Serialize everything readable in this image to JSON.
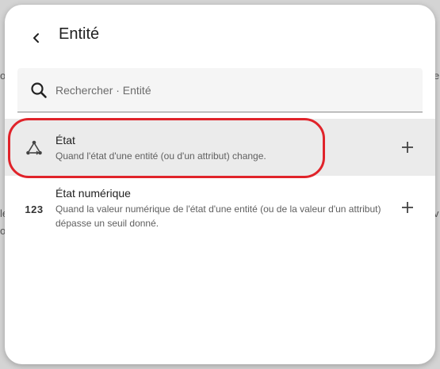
{
  "dialog": {
    "title": "Entité",
    "search": {
      "placeholder": "Rechercher · Entité",
      "value": ""
    },
    "items": [
      {
        "title": "État",
        "description": "Quand l'état d'une entité (ou d'un attribut) change.",
        "icon": "state-graph-icon"
      },
      {
        "title": "État numérique",
        "description": "Quand la valeur numérique de l'état d'une entité (ou de la valeur d'un attribut) dépasse un seuil donné.",
        "icon_text": "123"
      }
    ]
  },
  "background": {
    "left_fragments": [
      "o",
      "le",
      "o"
    ],
    "right_fragments": [
      "e",
      "v"
    ]
  },
  "colors": {
    "highlight": "#e0232a",
    "selected_row": "#ebebeb",
    "backdrop": "#d4d4d4"
  }
}
